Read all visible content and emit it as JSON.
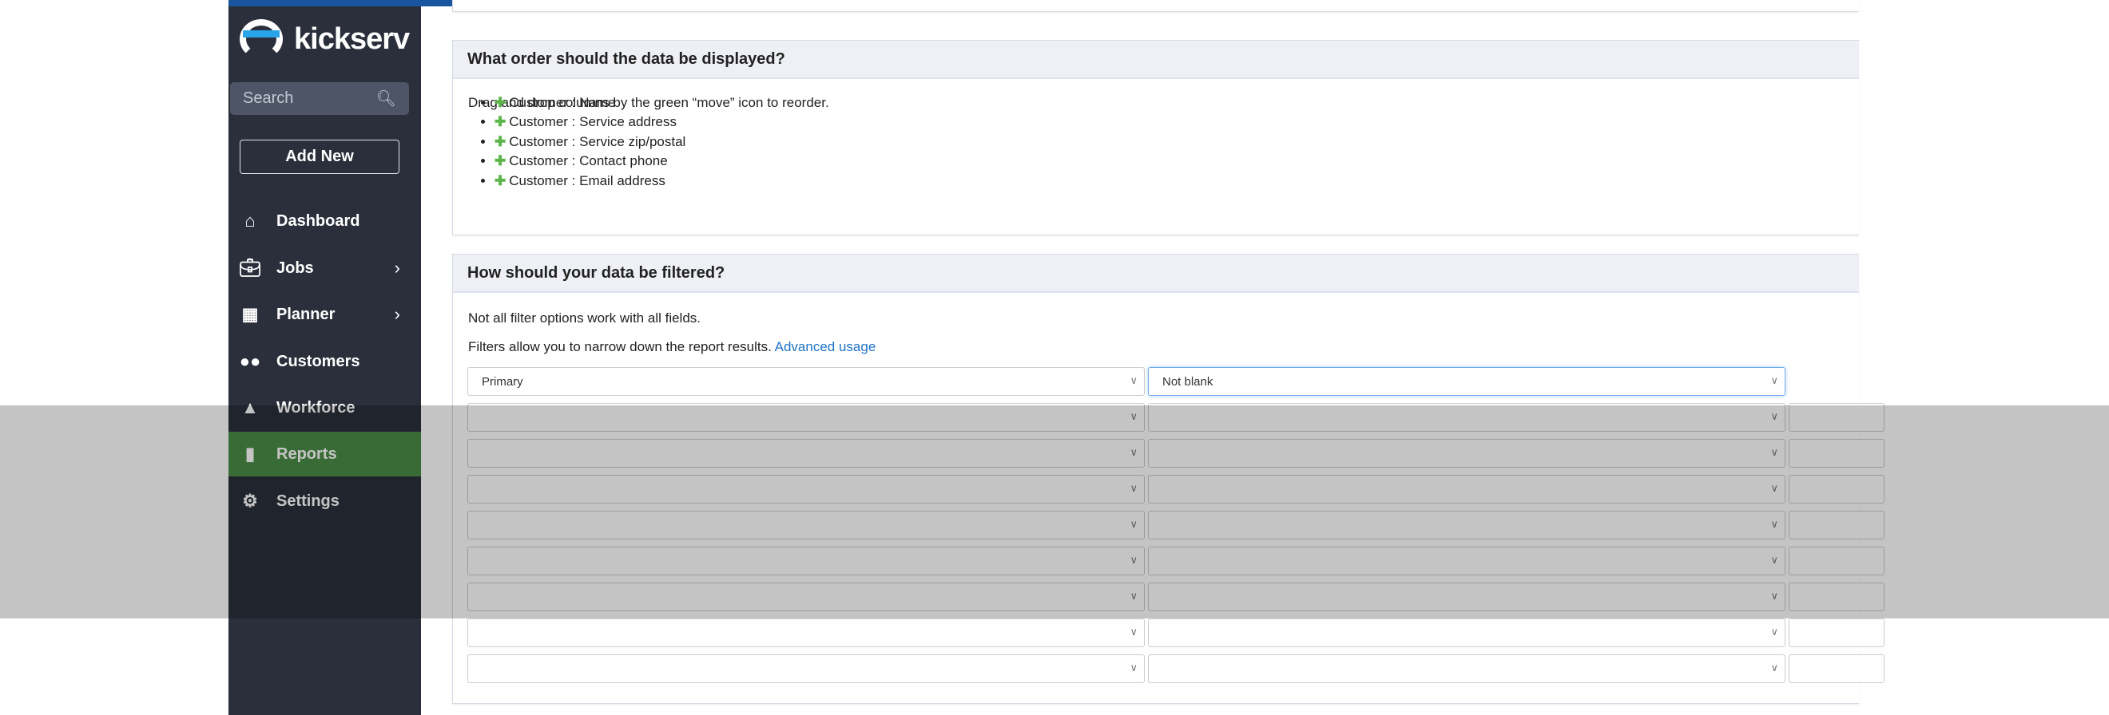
{
  "brand": {
    "name": "kickserv"
  },
  "sidebar": {
    "search_placeholder": "Search",
    "add_new": "Add New",
    "items": [
      {
        "label": "Dashboard",
        "icon": "home-icon"
      },
      {
        "label": "Jobs",
        "icon": "briefcase-icon"
      },
      {
        "label": "Planner",
        "icon": "calendar-icon"
      },
      {
        "label": "Customers",
        "icon": "users-icon"
      },
      {
        "label": "Workforce",
        "icon": "hardhat-icon"
      },
      {
        "label": "Reports",
        "icon": "bar-chart-icon",
        "active": true
      },
      {
        "label": "Settings",
        "icon": "gear-icon"
      }
    ]
  },
  "order": {
    "title": "What order should the data be displayed?",
    "instructions": "Drag and drop columns by the green “move” icon to reorder.",
    "columns": [
      "Customer : Name",
      "Customer : Service address",
      "Customer : Service zip/postal",
      "Customer : Contact phone",
      "Customer : Email address"
    ]
  },
  "filter": {
    "title": "How should your data be filtered?",
    "note": "Not all filter options work with all fields.",
    "intro": "Filters allow you to narrow down the report results.",
    "link": "Advanced usage",
    "rows": [
      {
        "field": "Primary",
        "operator": "Not blank"
      },
      {
        "field": "",
        "operator": ""
      },
      {
        "field": "",
        "operator": ""
      },
      {
        "field": "",
        "operator": ""
      },
      {
        "field": "",
        "operator": ""
      },
      {
        "field": "",
        "operator": ""
      },
      {
        "field": "",
        "operator": ""
      },
      {
        "field": "",
        "operator": ""
      },
      {
        "field": "",
        "operator": ""
      }
    ]
  },
  "colors": {
    "brand_blue": "#1a56a0",
    "sidebar": "#2a2f3b",
    "active": "#4a8c45",
    "link": "#1f73c5"
  }
}
